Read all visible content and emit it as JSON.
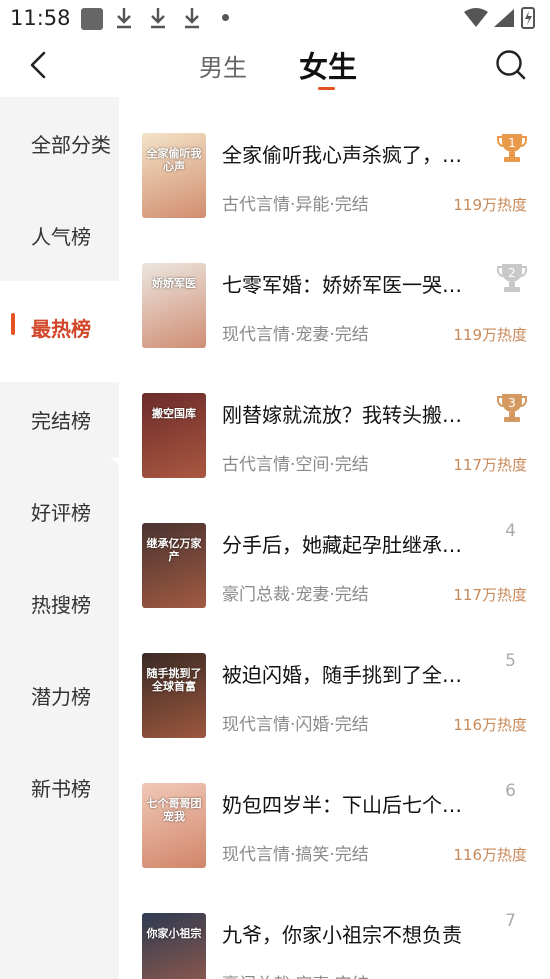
{
  "status_bar": {
    "time": "11:58"
  },
  "nav": {
    "tab_male": "男生",
    "tab_female": "女生"
  },
  "sidebar": {
    "items": [
      {
        "label": "全部分类"
      },
      {
        "label": "人气榜"
      },
      {
        "label": "最热榜"
      },
      {
        "label": "完结榜"
      },
      {
        "label": "好评榜"
      },
      {
        "label": "热搜榜"
      },
      {
        "label": "潜力榜"
      },
      {
        "label": "新书榜"
      }
    ],
    "active_index": 2
  },
  "books": [
    {
      "rank": "1",
      "title": "全家偷听我心声杀疯了，…",
      "tags": "古代言情·异能·完结",
      "heat": "119万热度",
      "cover_text": "全家偷听我心声",
      "cover_color": "#f3e3c8"
    },
    {
      "rank": "2",
      "title": "七零军婚：娇娇军医一哭…",
      "tags": "现代言情·宠妻·完结",
      "heat": "119万热度",
      "cover_text": "娇娇军医",
      "cover_color": "#ece6df"
    },
    {
      "rank": "3",
      "title": "刚替嫁就流放？我转头搬…",
      "tags": "古代言情·空间·完结",
      "heat": "117万热度",
      "cover_text": "搬空国库",
      "cover_color": "#6b2b2a"
    },
    {
      "rank": "4",
      "title": "分手后，她藏起孕肚继承…",
      "tags": "豪门总裁·宠妻·完结",
      "heat": "117万热度",
      "cover_text": "继承亿万家产",
      "cover_color": "#4a3330"
    },
    {
      "rank": "5",
      "title": "被迫闪婚，随手挑到了全…",
      "tags": "现代言情·闪婚·完结",
      "heat": "116万热度",
      "cover_text": "随手挑到了全球首富",
      "cover_color": "#3b2a24"
    },
    {
      "rank": "6",
      "title": "奶包四岁半：下山后七个…",
      "tags": "现代言情·搞笑·完结",
      "heat": "116万热度",
      "cover_text": "七个哥哥团宠我",
      "cover_color": "#f1c9b8"
    },
    {
      "rank": "7",
      "title": "九爷，你家小祖宗不想负责",
      "tags": "豪门总裁·宠妻·完结",
      "heat": "",
      "cover_text": "你家小祖宗",
      "cover_color": "#2f3b52"
    }
  ],
  "colors": {
    "accent": "#e4531f",
    "gold": "#e89a4a",
    "silver": "#c8c8c8",
    "bronze": "#d49a62",
    "heat": "#c98a5a"
  },
  "icons": {
    "back": "back-arrow-icon",
    "search": "search-icon",
    "trophy": "trophy-icon"
  }
}
